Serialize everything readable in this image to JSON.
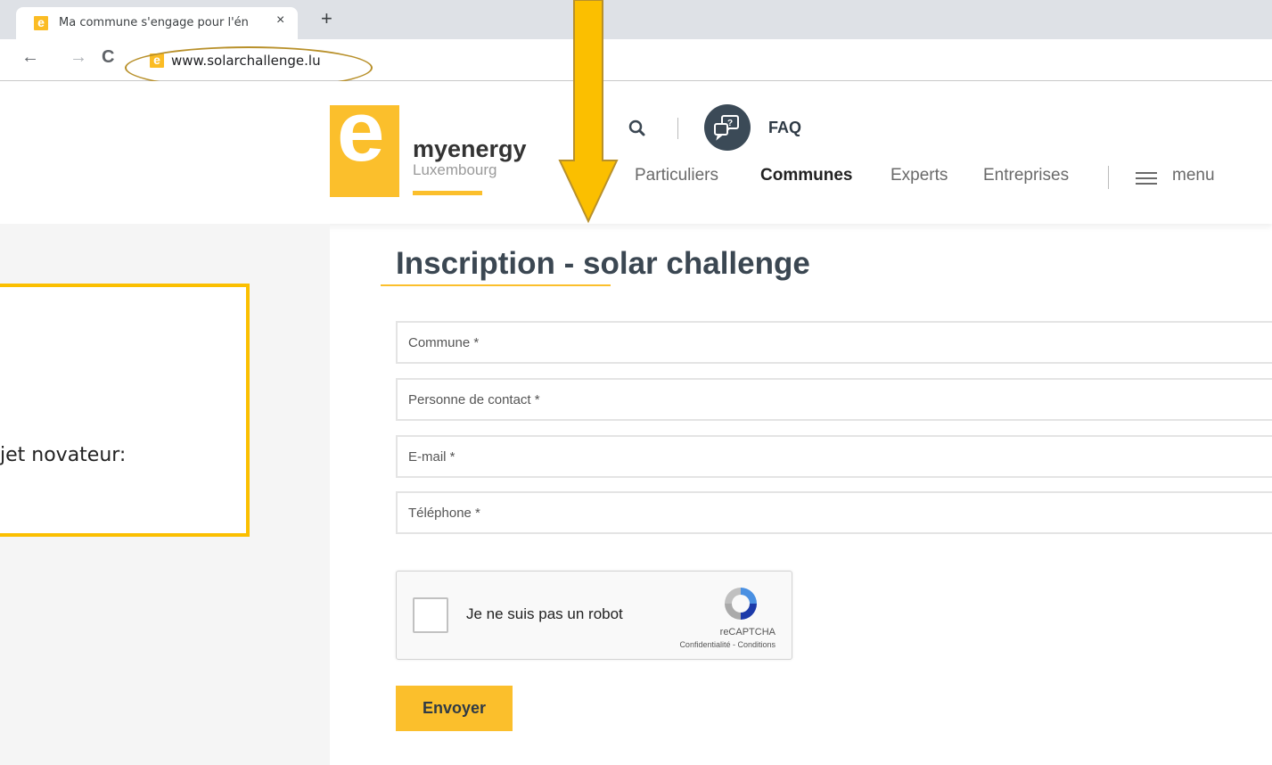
{
  "browser": {
    "tab_title": "Ma commune s'engage pour l'én",
    "tab_close": "×",
    "new_tab": "+",
    "back": "←",
    "forward": "→",
    "reload": "C",
    "favicon_letter": "e",
    "url": "www.solarchallenge.lu"
  },
  "header": {
    "logo_letter": "e",
    "brand_name": "myenergy",
    "brand_sub": "Luxembourg",
    "faq_label": "FAQ",
    "nav": [
      "Particuliers",
      "Communes",
      "Experts",
      "Entreprises"
    ],
    "active_nav": "Communes",
    "menu_label": "menu"
  },
  "sidebar": {
    "callout_text": "jet novateur:"
  },
  "form": {
    "title": "Inscription - solar challenge",
    "fields": [
      {
        "placeholder": "Commune *"
      },
      {
        "placeholder": "Personne de contact *"
      },
      {
        "placeholder": "E-mail *"
      },
      {
        "placeholder": "Téléphone *"
      }
    ],
    "captcha": {
      "label": "Je ne suis pas un robot",
      "brand": "reCAPTCHA",
      "links": "Confidentialité - Conditions"
    },
    "submit_label": "Envoyer"
  },
  "colors": {
    "brand_yellow": "#fbbf2c",
    "annotation_yellow": "#fbbf00",
    "dark_slate": "#3b4752"
  },
  "icons": [
    "search-icon",
    "faq-icon",
    "menu-icon",
    "recaptcha-icon",
    "arrow-annotation"
  ]
}
